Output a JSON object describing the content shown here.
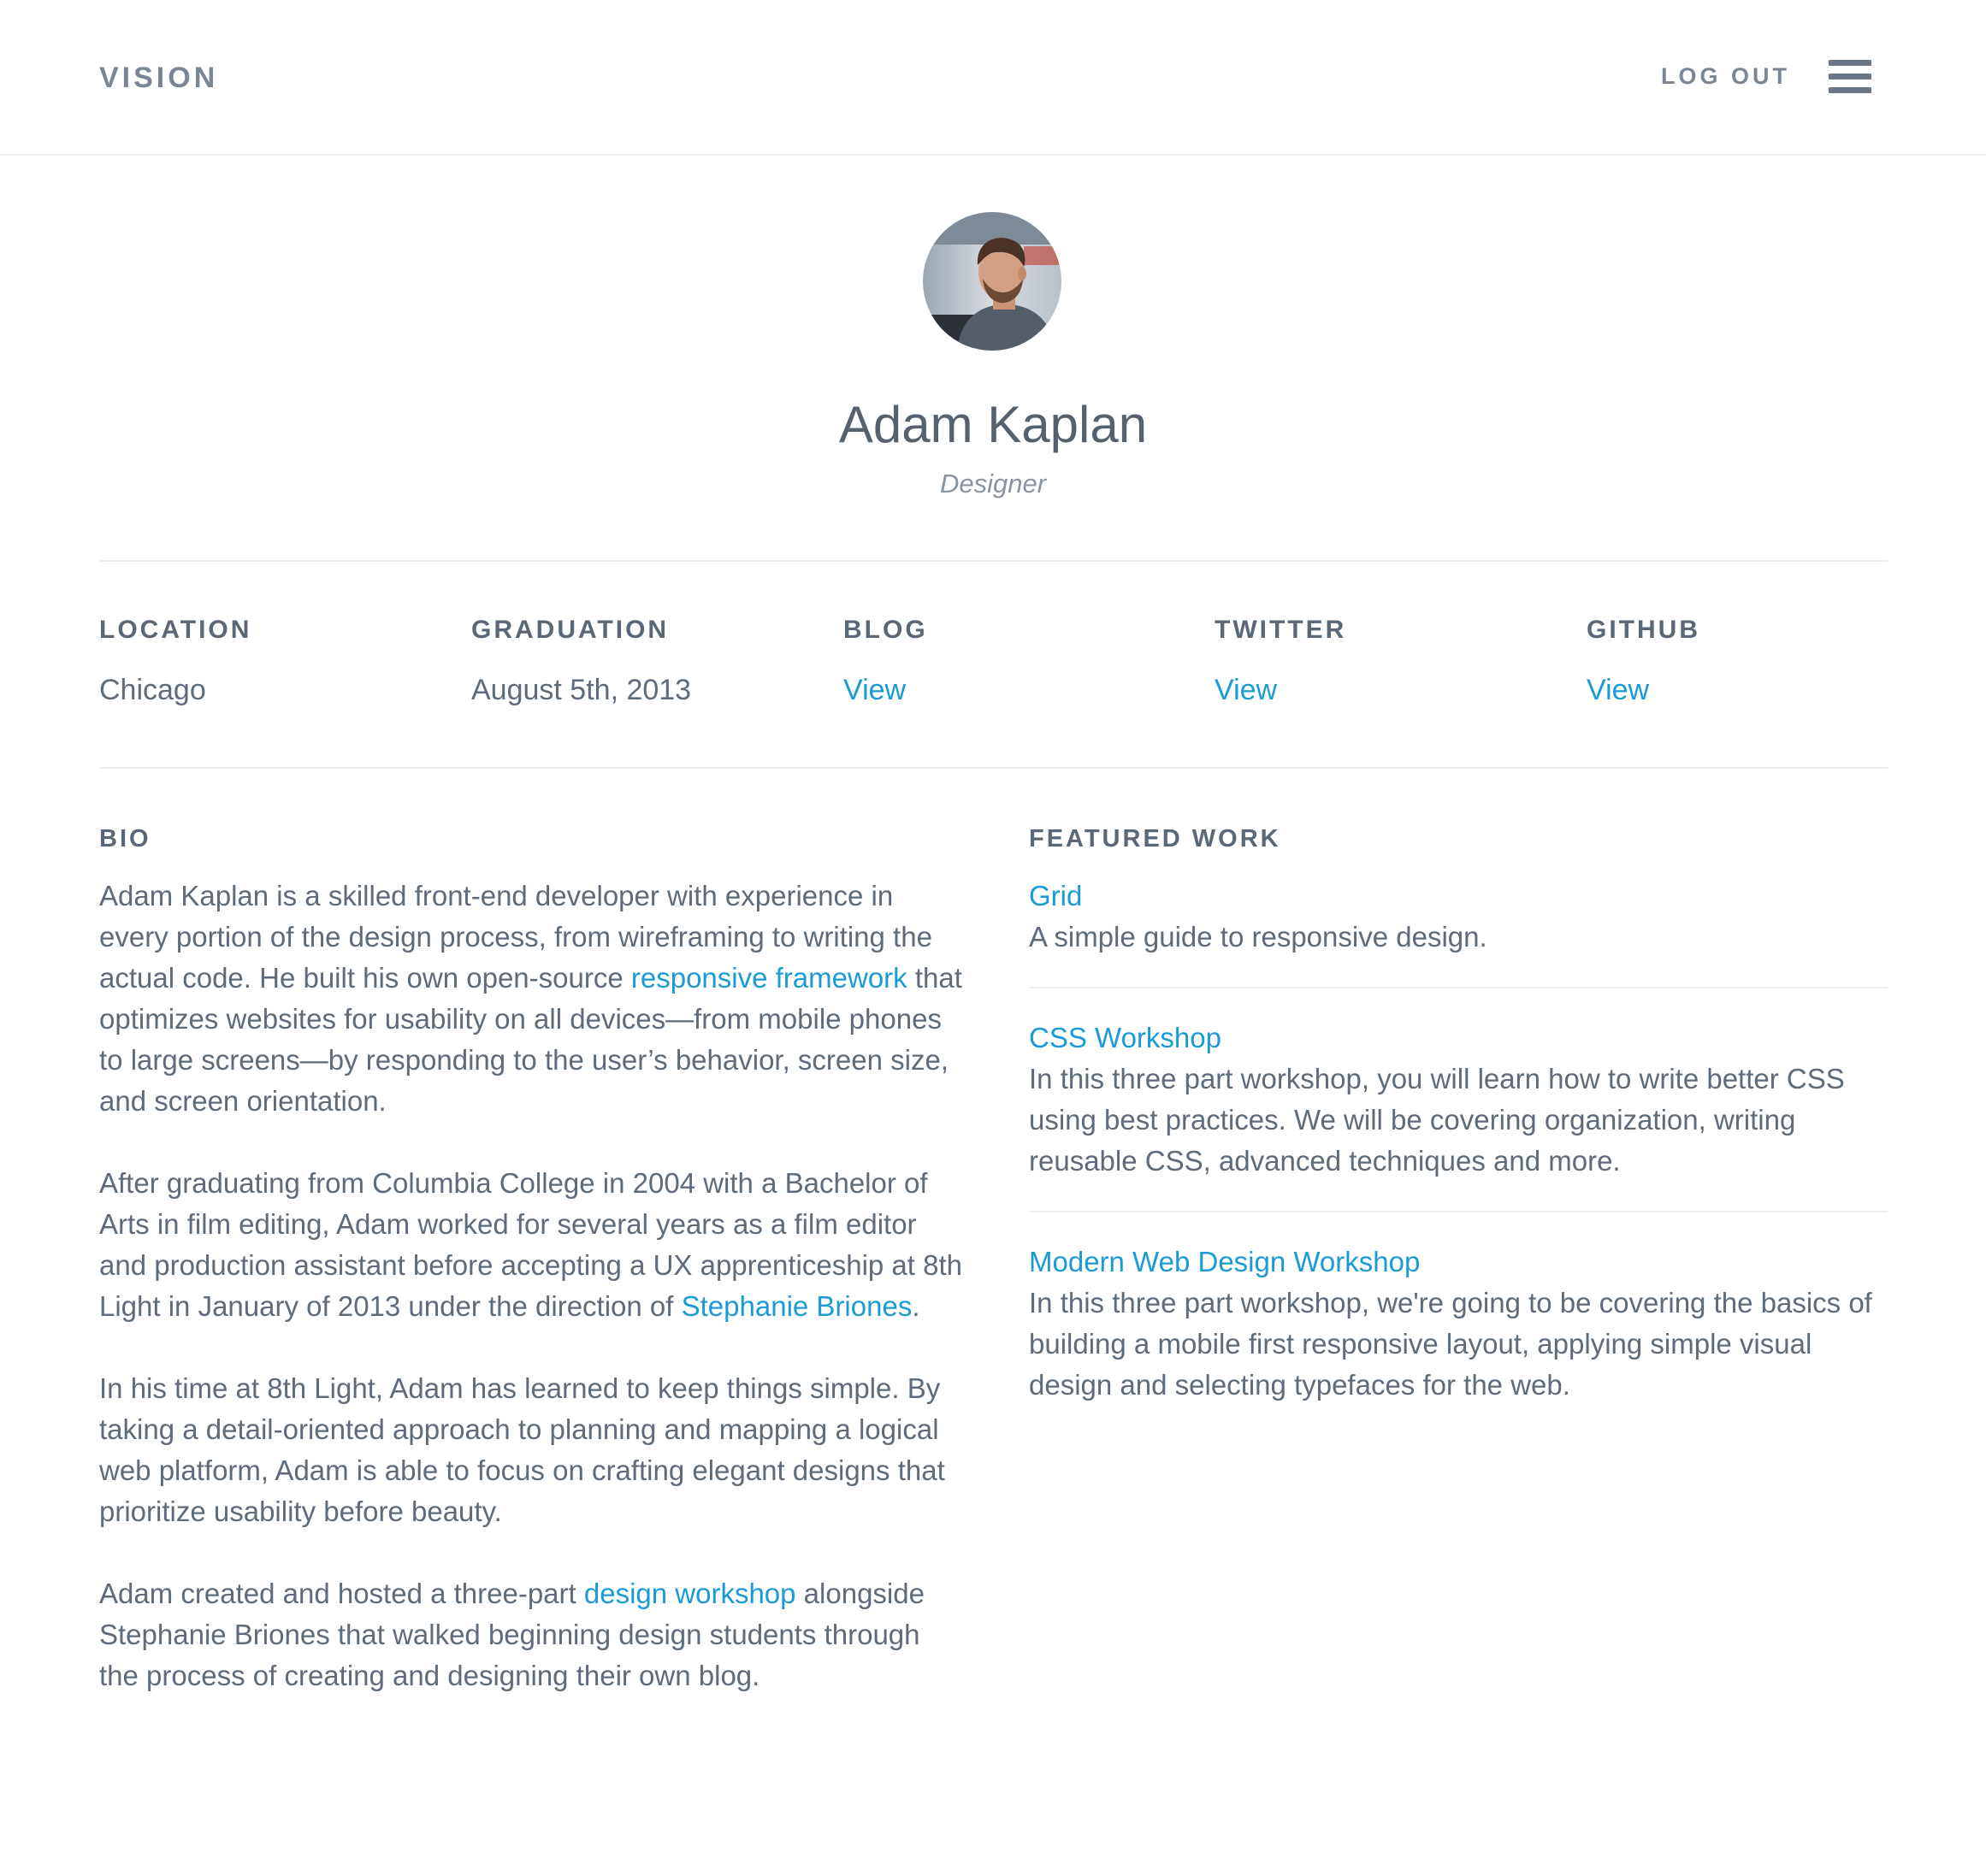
{
  "header": {
    "brand": "VISION",
    "logout_label": "LOG OUT",
    "menu_icon": "hamburger-icon"
  },
  "profile": {
    "name": "Adam Kaplan",
    "role": "Designer",
    "avatar": "profile-photo"
  },
  "info": [
    {
      "label": "LOCATION",
      "value": "Chicago"
    },
    {
      "label": "GRADUATION",
      "value": "August 5th, 2013"
    },
    {
      "label": "BLOG",
      "value": "View"
    },
    {
      "label": "TWITTER",
      "value": "View"
    },
    {
      "label": "GITHUB",
      "value": "View"
    }
  ],
  "bio": {
    "heading": "BIO",
    "p1_a": "Adam Kaplan is a skilled front-end developer with experience in every portion of the design process, from wireframing to writing the actual code. He built his own open-source ",
    "p1_link": "responsive framework",
    "p1_b": " that optimizes websites for usability on all devices—from mobile phones to large screens—by responding to the user’s behavior, screen size, and screen orientation.",
    "p2_a": "After graduating from Columbia College in 2004 with a Bachelor of Arts in film editing, Adam worked for several years as a film editor and production assistant before accepting a UX apprenticeship at 8th Light in January of 2013 under the direction of ",
    "p2_link": "Stephanie Briones",
    "p2_b": ".",
    "p3": "In his time at 8th Light, Adam has learned to keep things simple. By taking a detail-oriented approach to planning and mapping a logical web platform, Adam is able to focus on crafting elegant designs that prioritize usability before beauty.",
    "p4_a": "Adam created and hosted a three-part ",
    "p4_link": "design workshop",
    "p4_b": " alongside Stephanie Briones that walked beginning design students through the process of creating and designing their own blog."
  },
  "featured": {
    "heading": "FEATURED WORK",
    "items": [
      {
        "title": "Grid",
        "description": "A simple guide to responsive design."
      },
      {
        "title": "CSS Workshop",
        "description": "In this three part workshop, you will learn how to write better CSS using best practices. We will be covering organization, writing reusable CSS, advanced techniques and more."
      },
      {
        "title": "Modern Web Design Workshop",
        "description": "In this three part workshop, we're going to be covering the basics of building a mobile first responsive layout, applying simple visual design and selecting typefaces for the web."
      }
    ]
  },
  "colors": {
    "accent": "#1b9bd6",
    "text": "#5d6b7a",
    "muted": "#8a94a0",
    "divider": "#eceef1"
  }
}
